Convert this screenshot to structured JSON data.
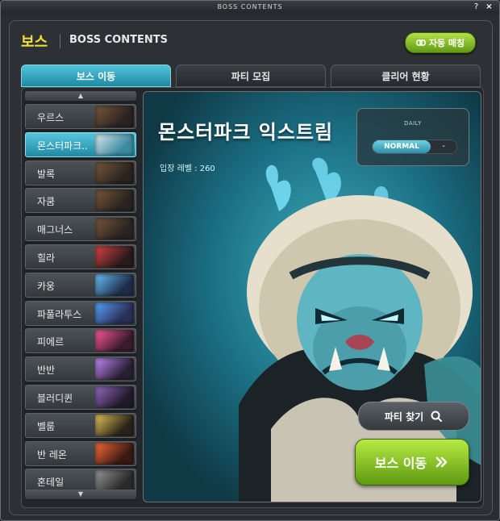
{
  "window": {
    "title": "BOSS CONTENTS",
    "help_label": "?",
    "close_label": "×"
  },
  "header": {
    "title_ko": "보스",
    "title_en": "BOSS CONTENTS",
    "auto_match_label": "자동 매칭"
  },
  "tabs": [
    {
      "label": "보스 이동",
      "active": true
    },
    {
      "label": "파티 모집",
      "active": false
    },
    {
      "label": "클리어 현황",
      "active": false
    }
  ],
  "boss_list": [
    {
      "name": "우르스"
    },
    {
      "name": "몬스터파크..",
      "selected": true
    },
    {
      "name": "발록"
    },
    {
      "name": "자쿰"
    },
    {
      "name": "매그너스"
    },
    {
      "name": "힐라"
    },
    {
      "name": "카웅"
    },
    {
      "name": "파풀라투스"
    },
    {
      "name": "피에르"
    },
    {
      "name": "반반"
    },
    {
      "name": "블러디퀸"
    },
    {
      "name": "벨룸"
    },
    {
      "name": "반 레온"
    },
    {
      "name": "혼테일"
    }
  ],
  "selected_boss": {
    "name": "몬스터파크 익스트림",
    "entry_level": "입장 레벨 : 260",
    "daily_label": "DAILY",
    "difficulty": "NORMAL",
    "count": "-"
  },
  "buttons": {
    "find_party": "파티 찾기",
    "boss_move": "보스 이동"
  },
  "icons": {
    "search": "search-icon",
    "double_chevron": "double-chevron-right-icon",
    "scroll_up": "chevron-up-icon",
    "scroll_down": "chevron-down-icon",
    "auto_match": "link-icon"
  },
  "colors": {
    "accent_teal": "#2aa3bd",
    "accent_green": "#7fbf1f",
    "title_yellow": "#f3e03a"
  }
}
